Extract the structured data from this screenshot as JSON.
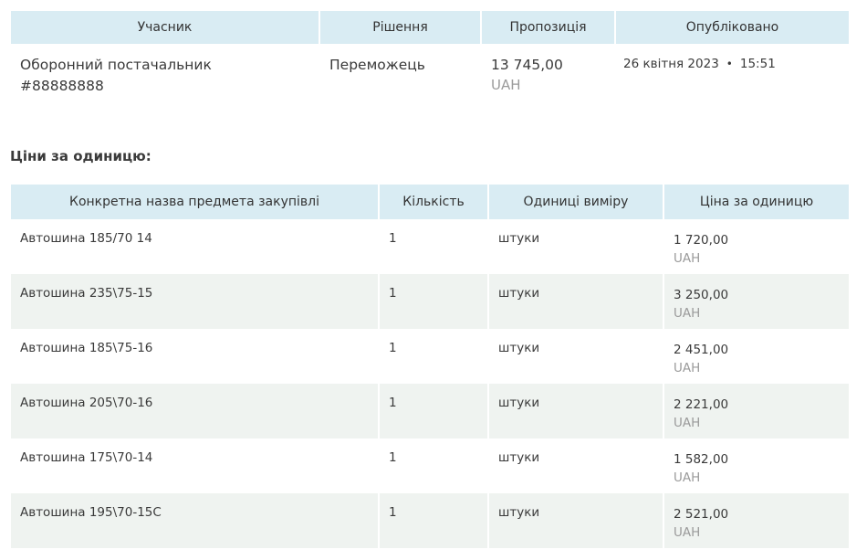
{
  "bid_table": {
    "headers": [
      "Учасник",
      "Рішення",
      "Пропозиція",
      "Опубліковано"
    ],
    "row": {
      "participant_line1": "Оборонний постачальник",
      "participant_line2": "#88888888",
      "decision": "Переможець",
      "offer_amount": "13 745,00",
      "offer_currency": "UAH",
      "published_date": "26 квітня 2023",
      "published_separator": "•",
      "published_time": "15:51"
    }
  },
  "unit_prices": {
    "title": "Ціни за одиницю:",
    "headers": [
      "Конкретна назва предмета закупівлі",
      "Кількість",
      "Одиниці виміру",
      "Ціна за одиницю"
    ],
    "rows": [
      {
        "name": "Автошина 185/70 14",
        "qty": "1",
        "unit": "штуки",
        "price": "1 720,00",
        "currency": "UAH"
      },
      {
        "name": "Автошина 235\\75-15",
        "qty": "1",
        "unit": "штуки",
        "price": "3 250,00",
        "currency": "UAH"
      },
      {
        "name": "Автошина 185\\75-16",
        "qty": "1",
        "unit": "штуки",
        "price": "2 451,00",
        "currency": "UAH"
      },
      {
        "name": "Автошина 205\\70-16",
        "qty": "1",
        "unit": "штуки",
        "price": "2 221,00",
        "currency": "UAH"
      },
      {
        "name": "Автошина 175\\70-14",
        "qty": "1",
        "unit": "штуки",
        "price": "1 582,00",
        "currency": "UAH"
      },
      {
        "name": "Автошина 195\\70-15С",
        "qty": "1",
        "unit": "штуки",
        "price": "2 521,00",
        "currency": "UAH"
      }
    ]
  },
  "colors": {
    "header_bg": "#d9ecf3",
    "alt_row_bg": "#eff3f0",
    "muted_text": "#9a9a9a"
  }
}
